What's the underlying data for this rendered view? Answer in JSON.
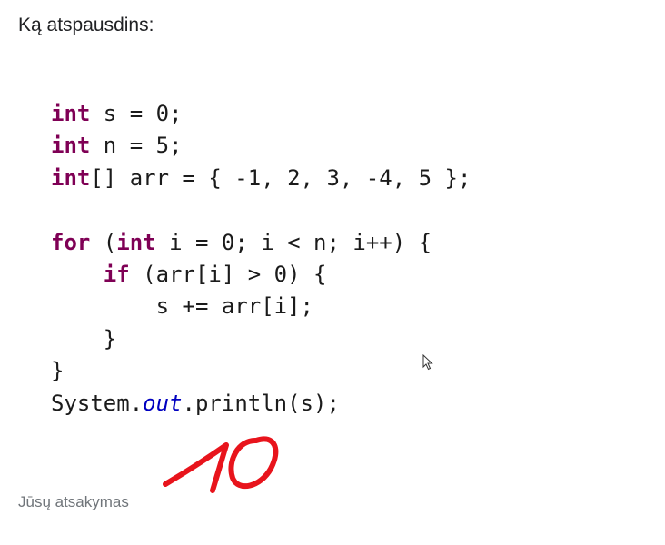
{
  "question": {
    "title": "Ką atspausdins:"
  },
  "code": {
    "lines": [
      [
        {
          "t": "int",
          "c": "kw"
        },
        {
          "t": " s = 0;"
        }
      ],
      [
        {
          "t": "int",
          "c": "kw"
        },
        {
          "t": " n = 5;"
        }
      ],
      [
        {
          "t": "int",
          "c": "kw"
        },
        {
          "t": "[] arr = { -1, 2, 3, -4, 5 };"
        }
      ],
      [
        {
          "t": ""
        }
      ],
      [
        {
          "t": "for",
          "c": "kw"
        },
        {
          "t": " ("
        },
        {
          "t": "int",
          "c": "kw"
        },
        {
          "t": " i = 0; i < n; i++) {"
        }
      ],
      [
        {
          "t": "    "
        },
        {
          "t": "if",
          "c": "kw"
        },
        {
          "t": " (arr[i] > 0) {"
        }
      ],
      [
        {
          "t": "        s += arr[i];"
        }
      ],
      [
        {
          "t": "    }"
        }
      ],
      [
        {
          "t": "}"
        }
      ],
      [
        {
          "t": "System."
        },
        {
          "t": "out",
          "c": "field"
        },
        {
          "t": ".println(s);"
        }
      ]
    ]
  },
  "answer": {
    "placeholder": "Jūsų atsakymas",
    "handwritten_value": "10",
    "handwriting_color": "#e8141c"
  },
  "icons": {
    "cursor": "mouse-pointer-icon"
  }
}
